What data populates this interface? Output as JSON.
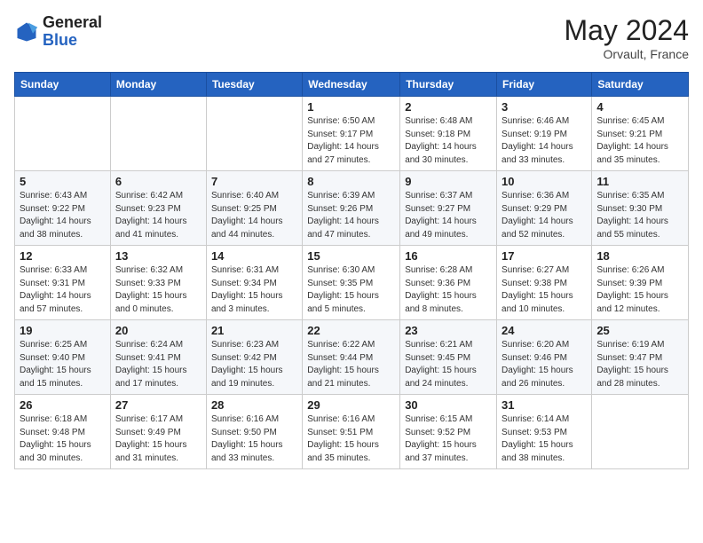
{
  "logo": {
    "general": "General",
    "blue": "Blue"
  },
  "title": {
    "month_year": "May 2024",
    "location": "Orvault, France"
  },
  "weekdays": [
    "Sunday",
    "Monday",
    "Tuesday",
    "Wednesday",
    "Thursday",
    "Friday",
    "Saturday"
  ],
  "weeks": [
    [
      {
        "day": "",
        "info": ""
      },
      {
        "day": "",
        "info": ""
      },
      {
        "day": "",
        "info": ""
      },
      {
        "day": "1",
        "info": "Sunrise: 6:50 AM\nSunset: 9:17 PM\nDaylight: 14 hours\nand 27 minutes."
      },
      {
        "day": "2",
        "info": "Sunrise: 6:48 AM\nSunset: 9:18 PM\nDaylight: 14 hours\nand 30 minutes."
      },
      {
        "day": "3",
        "info": "Sunrise: 6:46 AM\nSunset: 9:19 PM\nDaylight: 14 hours\nand 33 minutes."
      },
      {
        "day": "4",
        "info": "Sunrise: 6:45 AM\nSunset: 9:21 PM\nDaylight: 14 hours\nand 35 minutes."
      }
    ],
    [
      {
        "day": "5",
        "info": "Sunrise: 6:43 AM\nSunset: 9:22 PM\nDaylight: 14 hours\nand 38 minutes."
      },
      {
        "day": "6",
        "info": "Sunrise: 6:42 AM\nSunset: 9:23 PM\nDaylight: 14 hours\nand 41 minutes."
      },
      {
        "day": "7",
        "info": "Sunrise: 6:40 AM\nSunset: 9:25 PM\nDaylight: 14 hours\nand 44 minutes."
      },
      {
        "day": "8",
        "info": "Sunrise: 6:39 AM\nSunset: 9:26 PM\nDaylight: 14 hours\nand 47 minutes."
      },
      {
        "day": "9",
        "info": "Sunrise: 6:37 AM\nSunset: 9:27 PM\nDaylight: 14 hours\nand 49 minutes."
      },
      {
        "day": "10",
        "info": "Sunrise: 6:36 AM\nSunset: 9:29 PM\nDaylight: 14 hours\nand 52 minutes."
      },
      {
        "day": "11",
        "info": "Sunrise: 6:35 AM\nSunset: 9:30 PM\nDaylight: 14 hours\nand 55 minutes."
      }
    ],
    [
      {
        "day": "12",
        "info": "Sunrise: 6:33 AM\nSunset: 9:31 PM\nDaylight: 14 hours\nand 57 minutes."
      },
      {
        "day": "13",
        "info": "Sunrise: 6:32 AM\nSunset: 9:33 PM\nDaylight: 15 hours\nand 0 minutes."
      },
      {
        "day": "14",
        "info": "Sunrise: 6:31 AM\nSunset: 9:34 PM\nDaylight: 15 hours\nand 3 minutes."
      },
      {
        "day": "15",
        "info": "Sunrise: 6:30 AM\nSunset: 9:35 PM\nDaylight: 15 hours\nand 5 minutes."
      },
      {
        "day": "16",
        "info": "Sunrise: 6:28 AM\nSunset: 9:36 PM\nDaylight: 15 hours\nand 8 minutes."
      },
      {
        "day": "17",
        "info": "Sunrise: 6:27 AM\nSunset: 9:38 PM\nDaylight: 15 hours\nand 10 minutes."
      },
      {
        "day": "18",
        "info": "Sunrise: 6:26 AM\nSunset: 9:39 PM\nDaylight: 15 hours\nand 12 minutes."
      }
    ],
    [
      {
        "day": "19",
        "info": "Sunrise: 6:25 AM\nSunset: 9:40 PM\nDaylight: 15 hours\nand 15 minutes."
      },
      {
        "day": "20",
        "info": "Sunrise: 6:24 AM\nSunset: 9:41 PM\nDaylight: 15 hours\nand 17 minutes."
      },
      {
        "day": "21",
        "info": "Sunrise: 6:23 AM\nSunset: 9:42 PM\nDaylight: 15 hours\nand 19 minutes."
      },
      {
        "day": "22",
        "info": "Sunrise: 6:22 AM\nSunset: 9:44 PM\nDaylight: 15 hours\nand 21 minutes."
      },
      {
        "day": "23",
        "info": "Sunrise: 6:21 AM\nSunset: 9:45 PM\nDaylight: 15 hours\nand 24 minutes."
      },
      {
        "day": "24",
        "info": "Sunrise: 6:20 AM\nSunset: 9:46 PM\nDaylight: 15 hours\nand 26 minutes."
      },
      {
        "day": "25",
        "info": "Sunrise: 6:19 AM\nSunset: 9:47 PM\nDaylight: 15 hours\nand 28 minutes."
      }
    ],
    [
      {
        "day": "26",
        "info": "Sunrise: 6:18 AM\nSunset: 9:48 PM\nDaylight: 15 hours\nand 30 minutes."
      },
      {
        "day": "27",
        "info": "Sunrise: 6:17 AM\nSunset: 9:49 PM\nDaylight: 15 hours\nand 31 minutes."
      },
      {
        "day": "28",
        "info": "Sunrise: 6:16 AM\nSunset: 9:50 PM\nDaylight: 15 hours\nand 33 minutes."
      },
      {
        "day": "29",
        "info": "Sunrise: 6:16 AM\nSunset: 9:51 PM\nDaylight: 15 hours\nand 35 minutes."
      },
      {
        "day": "30",
        "info": "Sunrise: 6:15 AM\nSunset: 9:52 PM\nDaylight: 15 hours\nand 37 minutes."
      },
      {
        "day": "31",
        "info": "Sunrise: 6:14 AM\nSunset: 9:53 PM\nDaylight: 15 hours\nand 38 minutes."
      },
      {
        "day": "",
        "info": ""
      }
    ]
  ]
}
